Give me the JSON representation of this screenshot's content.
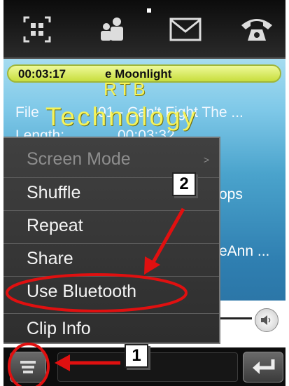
{
  "status": {
    "elapsed_time": "00:03:17",
    "now_playing": "e Moonlight"
  },
  "watermark": {
    "line1": "RTB",
    "line2": "Technology"
  },
  "track_info": {
    "file_label": "File",
    "file_value": "01 - Can't Fight The ...",
    "length_label": "Length:",
    "length_value": "00:03:32",
    "partial_right_1": "ops",
    "partial_right_2": "eAnn ..."
  },
  "menu": {
    "items": [
      {
        "label": "Screen Mode",
        "enabled": false,
        "has_submenu": true,
        "arrow": ">"
      },
      {
        "label": "Shuffle",
        "enabled": true
      },
      {
        "label": "Repeat",
        "enabled": true
      },
      {
        "label": "Share",
        "enabled": true
      },
      {
        "label": "Use Bluetooth",
        "enabled": true,
        "highlighted": true
      },
      {
        "label": "Clip Info",
        "enabled": true
      }
    ]
  },
  "toolbar": {
    "icons": [
      "contacts-grid-icon",
      "people-icon",
      "envelope-icon",
      "phone-icon"
    ]
  },
  "annotations": {
    "step1": "1",
    "step2": "2",
    "arrow_color": "#e01010",
    "highlight_color": "#e01010"
  },
  "colors": {
    "time_bar": "#d8ea5a",
    "watermark": "#f5f35a",
    "menu_bg": "#363636"
  }
}
